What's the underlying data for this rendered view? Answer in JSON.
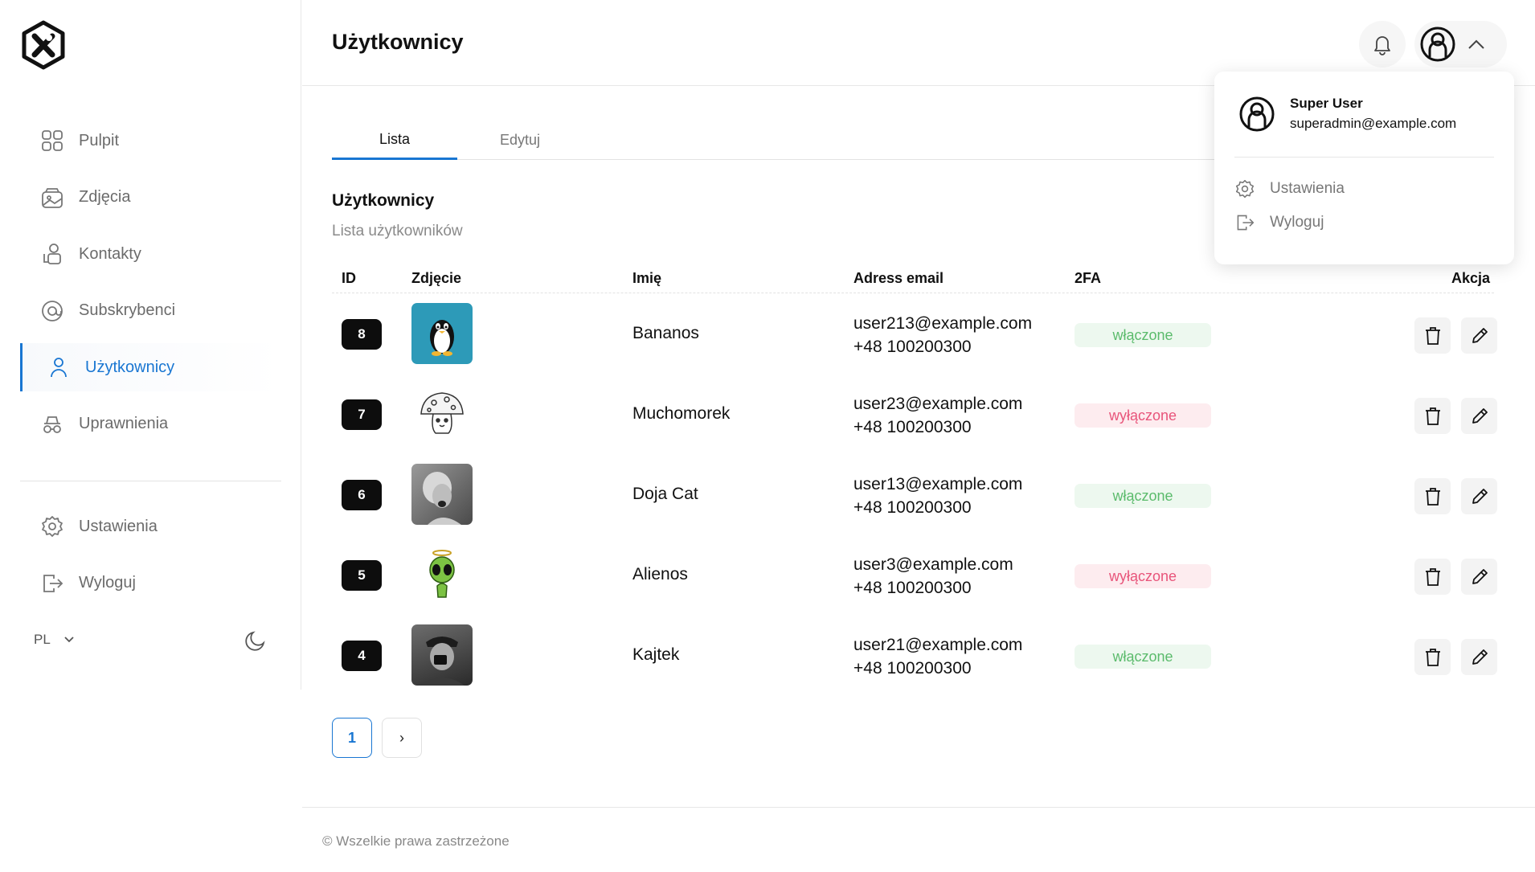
{
  "app": {
    "logo": "x-hexagon-logo"
  },
  "sidebar": {
    "items": [
      {
        "label": "Pulpit",
        "icon": "grid-icon"
      },
      {
        "label": "Zdjęcia",
        "icon": "gallery-icon"
      },
      {
        "label": "Kontakty",
        "icon": "contacts-icon"
      },
      {
        "label": "Subskrybenci",
        "icon": "at-icon"
      },
      {
        "label": "Użytkownicy",
        "icon": "user-icon",
        "active": true
      },
      {
        "label": "Uprawnienia",
        "icon": "incognito-icon"
      }
    ],
    "bottom": [
      {
        "label": "Ustawienia",
        "icon": "gear-icon"
      },
      {
        "label": "Wyloguj",
        "icon": "logout-icon"
      }
    ],
    "language": "PL"
  },
  "header": {
    "title": "Użytkownicy"
  },
  "tabs": [
    {
      "label": "Lista",
      "active": true
    },
    {
      "label": "Edytuj"
    }
  ],
  "section": {
    "title": "Użytkownicy",
    "subtitle": "Lista użytkowników"
  },
  "table": {
    "columns": {
      "id": "ID",
      "photo": "Zdjęcie",
      "name": "Imię",
      "email": "Adress email",
      "tfa": "2FA",
      "action": "Akcja"
    },
    "rows": [
      {
        "id": "8",
        "name": "Bananos",
        "email": "user213@example.com",
        "phone": "+48 100200300",
        "tfa": "włączone",
        "tfa_on": true,
        "photo": "penguin"
      },
      {
        "id": "7",
        "name": "Muchomorek",
        "email": "user23@example.com",
        "phone": "+48 100200300",
        "tfa": "wyłączone",
        "tfa_on": false,
        "photo": "mushroom"
      },
      {
        "id": "6",
        "name": "Doja Cat",
        "email": "user13@example.com",
        "phone": "+48 100200300",
        "tfa": "włączone",
        "tfa_on": true,
        "photo": "portrait-bw"
      },
      {
        "id": "5",
        "name": "Alienos",
        "email": "user3@example.com",
        "phone": "+48 100200300",
        "tfa": "wyłączone",
        "tfa_on": false,
        "photo": "alien"
      },
      {
        "id": "4",
        "name": "Kajtek",
        "email": "user21@example.com",
        "phone": "+48 100200300",
        "tfa": "włączone",
        "tfa_on": true,
        "photo": "selfie-bw"
      }
    ]
  },
  "pagination": {
    "current": "1",
    "next": "›"
  },
  "footer": {
    "text": "© Wszelkie prawa zastrzeżone"
  },
  "user_menu": {
    "name": "Super User",
    "email": "superadmin@example.com",
    "items": [
      {
        "label": "Ustawienia",
        "icon": "gear-icon"
      },
      {
        "label": "Wyloguj",
        "icon": "logout-icon"
      }
    ]
  },
  "colors": {
    "accent": "#1976d2",
    "on": "#5bbb6c",
    "off": "#e8547a"
  }
}
